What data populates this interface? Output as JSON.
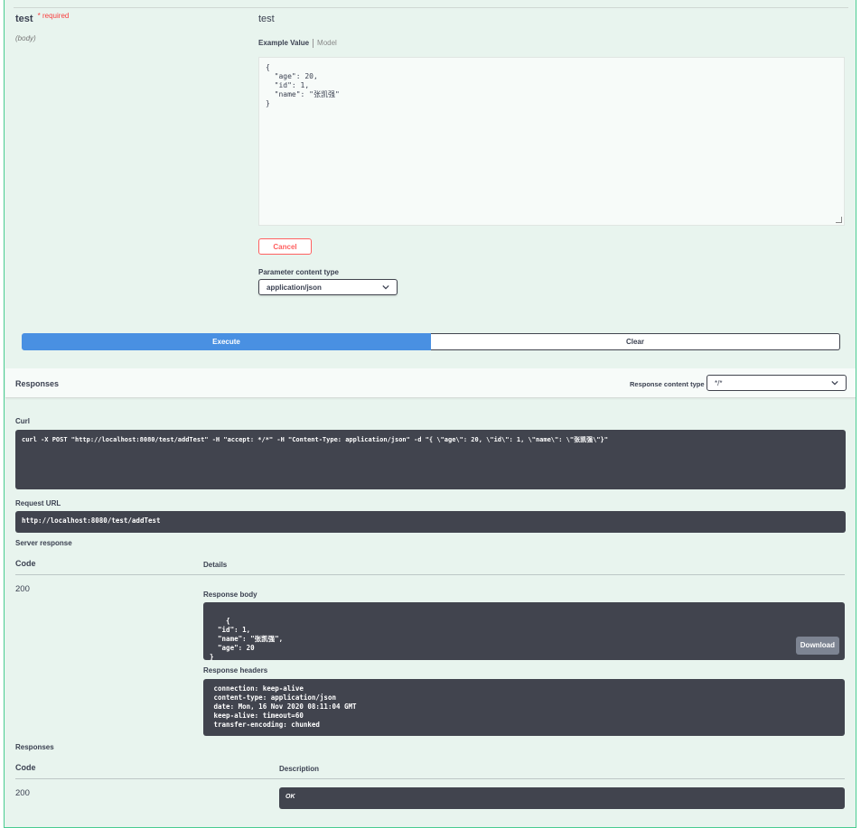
{
  "parameter": {
    "name": "test",
    "required_marker": "*",
    "required_label": "required",
    "in": "(body)",
    "description": "test",
    "tab_example": "Example Value",
    "tab_model": "Model",
    "body_value": "{\n  \"age\": 20,\n  \"id\": 1,\n  \"name\": \"张凯强\"\n}",
    "cancel_label": "Cancel",
    "content_type_label": "Parameter content type",
    "content_type_value": "application/json"
  },
  "actions": {
    "execute_label": "Execute",
    "clear_label": "Clear"
  },
  "responses_header": {
    "title": "Responses",
    "content_type_label": "Response content type",
    "content_type_value": "*/*"
  },
  "curl": {
    "label": "Curl",
    "command": "curl -X POST \"http://localhost:8080/test/addTest\" -H \"accept: */*\" -H \"Content-Type: application/json\" -d \"{ \\\"age\\\": 20, \\\"id\\\": 1, \\\"name\\\": \\\"张凯强\\\"}\""
  },
  "request_url": {
    "label": "Request URL",
    "value": "http://localhost:8080/test/addTest"
  },
  "server_response": {
    "label": "Server response",
    "col_code": "Code",
    "col_details": "Details",
    "code": "200",
    "body_label": "Response body",
    "body": "{\n  \"id\": 1,\n  \"name\": \"张凯强\",\n  \"age\": 20\n}",
    "download_label": "Download",
    "headers_label": "Response headers",
    "headers": " connection: keep-alive\n content-type: application/json\n date: Mon, 16 Nov 2020 08:11:04 GMT\n keep-alive: timeout=60\n transfer-encoding: chunked"
  },
  "responses": {
    "label": "Responses",
    "col_code": "Code",
    "col_description": "Description",
    "code": "200",
    "description": "OK"
  },
  "colors": {
    "panel_bg": "#e8f4ee",
    "panel_border": "#49cc90",
    "execute_blue": "#4990e2",
    "dark_box": "#41444e",
    "required_red": "#f93e3e"
  }
}
